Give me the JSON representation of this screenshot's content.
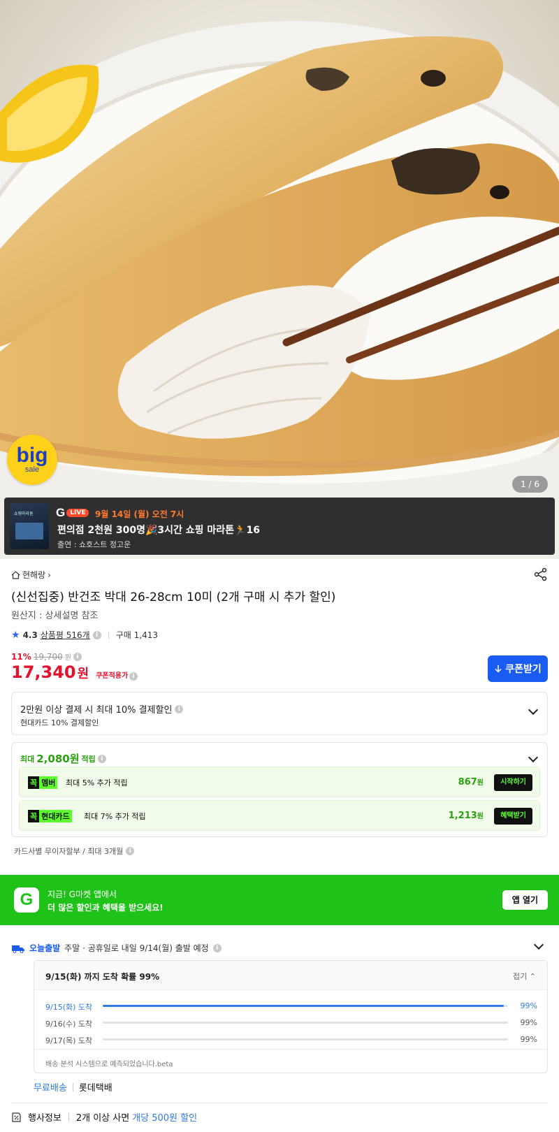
{
  "hero": {
    "big_sale_line1": "big",
    "big_sale_line2": "sale",
    "image_counter": "1 / 6"
  },
  "live": {
    "logo_g": "G",
    "logo_badge": "LIVE",
    "thumb_text": "쇼핑마라톤",
    "date": "9월 14일 (월) 오전 7시",
    "title": "편의점 2천원 300명🎉3시간 쇼핑 마라톤🏃16",
    "cast": "출연 : 쇼호스트 정고운"
  },
  "product": {
    "store": "현해랑",
    "title": "(신선집중) 반건조 박대 26-28cm 10미 (2개 구매 시 추가 할인)",
    "origin": "원산지 : 상세설명 참조",
    "rating": "4.3",
    "reviews": "상품평 516개",
    "purchases": "구매 1,413",
    "discount_pct": "11%",
    "original_price": "19,700",
    "original_unit": "원",
    "price": "17,340",
    "price_unit": "원",
    "coupon_applied": "쿠폰적용가",
    "coupon_button": "쿠폰받기"
  },
  "card_discount": {
    "line1": "2만원 이상 결제 시 최대 10% 결제할인",
    "line2": "현대카드 10% 결제할인"
  },
  "reward": {
    "prefix": "최대",
    "amount": "2,080원",
    "suffix": "적립",
    "rows": [
      {
        "tag_k": "꼭",
        "tag_n": "멤버",
        "desc": "최대 5% 추가 적립",
        "amount": "867",
        "unit": "원",
        "button": "시작하기"
      },
      {
        "tag_k": "꼭",
        "tag_n": "현대카드",
        "desc": "최대 7% 추가 적립",
        "amount": "1,213",
        "unit": "원",
        "button": "혜택받기"
      }
    ]
  },
  "installment": "카드사별 무이자할부 / 최대 3개월",
  "app_banner": {
    "logo": "G",
    "line1": "지금! G마켓 앱에서",
    "line2": "더 많은 할인과 혜택을 받으세요!",
    "button": "앱 열기"
  },
  "shipping": {
    "badge": "오늘출발",
    "text": "주말 · 공휴일로 내일 9/14(월) 출발 예정",
    "box_title": "9/15(화) 까지 도착 확률 99%",
    "fold": "접기",
    "rows": [
      {
        "date": "9/15(화) 도착",
        "pct": "99%",
        "fill": 0.99
      },
      {
        "date": "9/16(수) 도착",
        "pct": "99%",
        "fill": 0
      },
      {
        "date": "9/17(목) 도착",
        "pct": "99%",
        "fill": 0
      }
    ],
    "footnote": "배송 분석 시스템으로 예측되었습니다.beta",
    "free": "무료배송",
    "carrier": "롯데택배"
  },
  "event": {
    "label": "행사정보",
    "text": "2개 이상 사면",
    "highlight": "개당 500원 할인"
  },
  "colors": {
    "accent_blue": "#1a5cf2",
    "price_red": "#e3132d",
    "green": "#1fc217"
  }
}
